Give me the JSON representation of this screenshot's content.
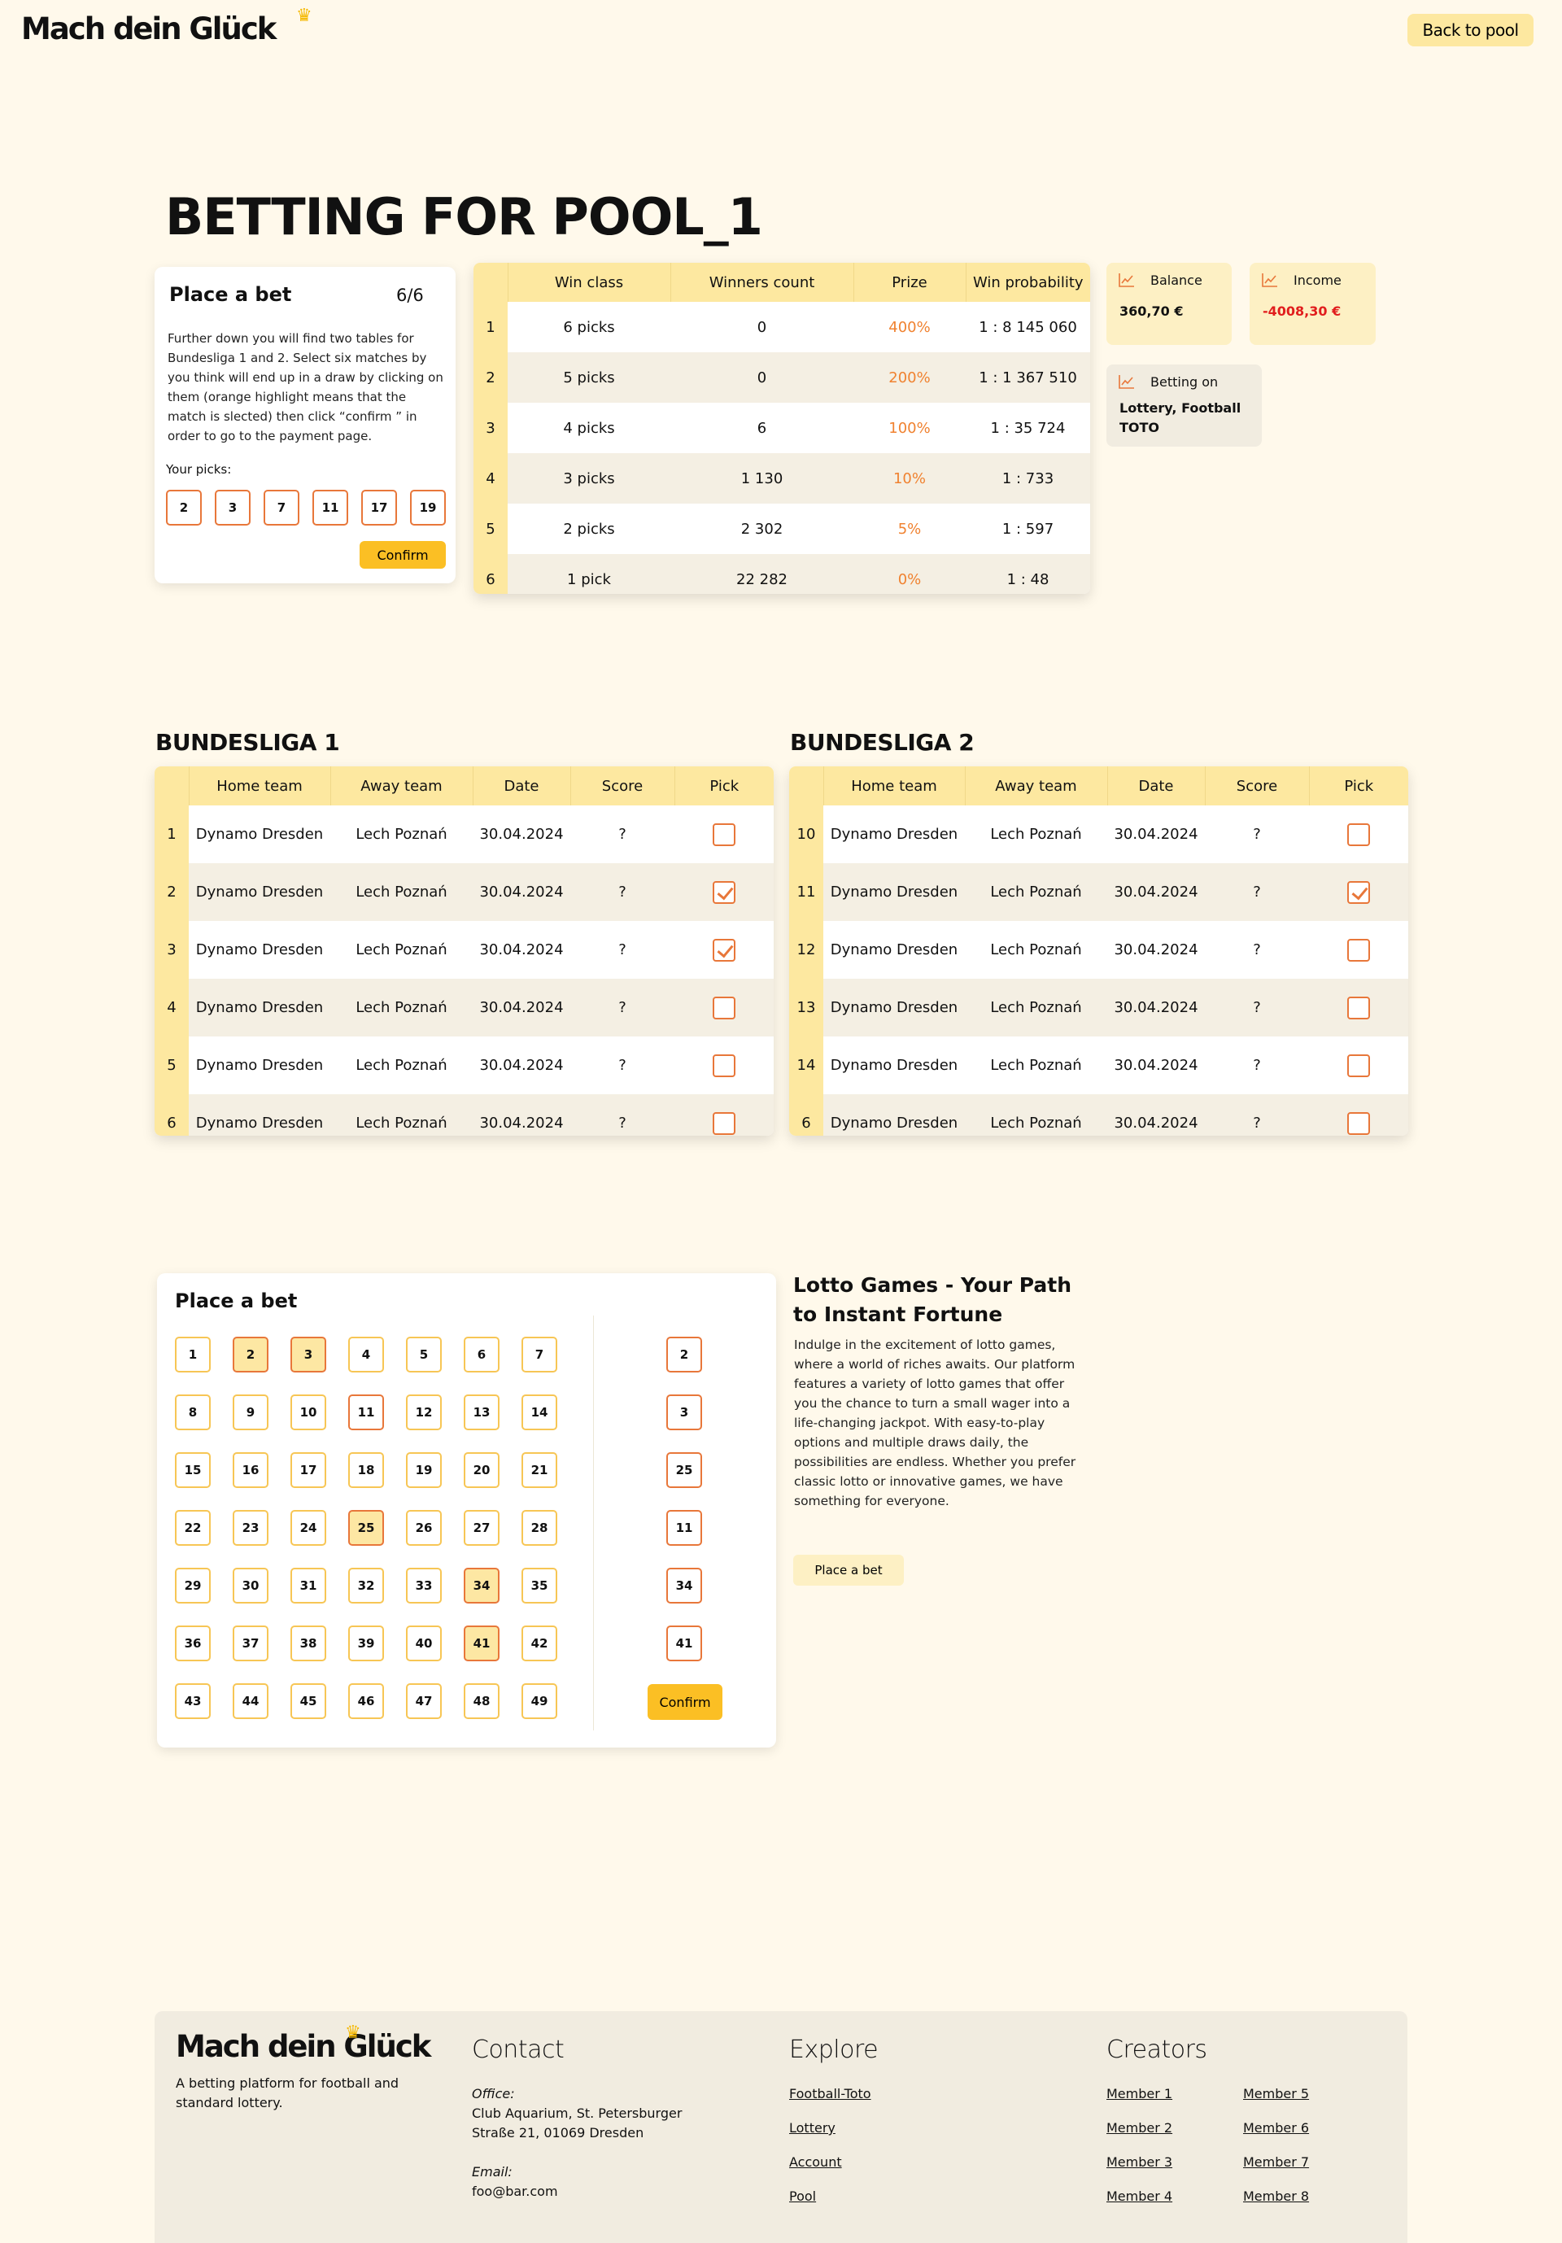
{
  "header": {
    "logo": "Mach dein Glück",
    "back_label": "Back to pool"
  },
  "page_title": "BETTING FOR POOL_1",
  "bet_card": {
    "title": "Place a bet",
    "count": "6/6",
    "description": "Further down you will find two tables for Bundesliga 1 and 2. Select six matches by you think will end up in a draw by clicking on them (orange highlight means that the match is slected) then click “confirm ” in order to go to the payment page.",
    "picks_label": "Your picks:",
    "picks": [
      "2",
      "3",
      "7",
      "11",
      "17",
      "19"
    ],
    "confirm_label": "Confirm"
  },
  "win_table": {
    "headers": [
      "Win class",
      "Winners count",
      "Prize",
      "Win probability"
    ],
    "rows": [
      {
        "idx": "1",
        "cls": "6 picks",
        "winners": "0",
        "prize": "400%",
        "prob": "1 : 8 145 060"
      },
      {
        "idx": "2",
        "cls": "5 picks",
        "winners": "0",
        "prize": "200%",
        "prob": "1 : 1 367 510"
      },
      {
        "idx": "3",
        "cls": "4 picks",
        "winners": "6",
        "prize": "100%",
        "prob": "1 : 35 724"
      },
      {
        "idx": "4",
        "cls": "3 picks",
        "winners": "1 130",
        "prize": "10%",
        "prob": "1 : 733"
      },
      {
        "idx": "5",
        "cls": "2 picks",
        "winners": "2 302",
        "prize": "5%",
        "prob": "1 : 597"
      },
      {
        "idx": "6",
        "cls": "1 pick",
        "winners": "22 282",
        "prize": "0%",
        "prob": "1 : 48"
      }
    ]
  },
  "stats": {
    "balance": {
      "label": "Balance",
      "value": "360,70 €"
    },
    "income": {
      "label": "Income",
      "value": "-4008,30 €"
    },
    "betting_on": {
      "label": "Betting on",
      "line1": "Lottery, Football",
      "line2": "TOTO"
    }
  },
  "bundesliga1": {
    "title": "BUNDESLIGA 1",
    "headers": [
      "Home team",
      "Away team",
      "Date",
      "Score",
      "Pick"
    ],
    "rows": [
      {
        "idx": "1",
        "home": "Dynamo Dresden",
        "away": "Lech Poznań",
        "date": "30.04.2024",
        "score": "?",
        "picked": false
      },
      {
        "idx": "2",
        "home": "Dynamo Dresden",
        "away": "Lech Poznań",
        "date": "30.04.2024",
        "score": "?",
        "picked": true
      },
      {
        "idx": "3",
        "home": "Dynamo Dresden",
        "away": "Lech Poznań",
        "date": "30.04.2024",
        "score": "?",
        "picked": true
      },
      {
        "idx": "4",
        "home": "Dynamo Dresden",
        "away": "Lech Poznań",
        "date": "30.04.2024",
        "score": "?",
        "picked": false
      },
      {
        "idx": "5",
        "home": "Dynamo Dresden",
        "away": "Lech Poznań",
        "date": "30.04.2024",
        "score": "?",
        "picked": false
      },
      {
        "idx": "6",
        "home": "Dynamo Dresden",
        "away": "Lech Poznań",
        "date": "30.04.2024",
        "score": "?",
        "picked": false
      }
    ]
  },
  "bundesliga2": {
    "title": "BUNDESLIGA 2",
    "headers": [
      "Home team",
      "Away team",
      "Date",
      "Score",
      "Pick"
    ],
    "rows": [
      {
        "idx": "10",
        "home": "Dynamo Dresden",
        "away": "Lech Poznań",
        "date": "30.04.2024",
        "score": "?",
        "picked": false
      },
      {
        "idx": "11",
        "home": "Dynamo Dresden",
        "away": "Lech Poznań",
        "date": "30.04.2024",
        "score": "?",
        "picked": true
      },
      {
        "idx": "12",
        "home": "Dynamo Dresden",
        "away": "Lech Poznań",
        "date": "30.04.2024",
        "score": "?",
        "picked": false
      },
      {
        "idx": "13",
        "home": "Dynamo Dresden",
        "away": "Lech Poznań",
        "date": "30.04.2024",
        "score": "?",
        "picked": false
      },
      {
        "idx": "14",
        "home": "Dynamo Dresden",
        "away": "Lech Poznań",
        "date": "30.04.2024",
        "score": "?",
        "picked": false
      },
      {
        "idx": "6",
        "home": "Dynamo Dresden",
        "away": "Lech Poznań",
        "date": "30.04.2024",
        "score": "?",
        "picked": false
      }
    ]
  },
  "lotto": {
    "title": "Place a bet",
    "numbers": [
      "1",
      "2",
      "3",
      "4",
      "5",
      "6",
      "7",
      "8",
      "9",
      "10",
      "11",
      "12",
      "13",
      "14",
      "15",
      "16",
      "17",
      "18",
      "19",
      "20",
      "21",
      "22",
      "23",
      "24",
      "25",
      "26",
      "27",
      "28",
      "29",
      "30",
      "31",
      "32",
      "33",
      "34",
      "35",
      "36",
      "37",
      "38",
      "39",
      "40",
      "41",
      "42",
      "43",
      "44",
      "45",
      "46",
      "47",
      "48",
      "49"
    ],
    "selected": [
      "2",
      "3",
      "25",
      "34",
      "41"
    ],
    "outlined": [
      "11"
    ],
    "side_picks": [
      "2",
      "3",
      "25",
      "11",
      "34",
      "41"
    ],
    "confirm_label": "Confirm"
  },
  "promo": {
    "title": "Lotto Games - Your Path to Instant Fortune",
    "text": "Indulge in the excitement of lotto games, where a world of riches awaits. Our platform features a variety of lotto games that offer you the chance to turn a small wager into a life-changing jackpot. With easy-to-play options and multiple draws daily, the possibilities are endless. Whether you prefer classic lotto or innovative games, we have something for everyone.",
    "button_label": "Place a bet"
  },
  "footer": {
    "logo": "Mach dein Glück",
    "tagline": "A betting platform for football and standard lottery.",
    "contact": {
      "title": "Contact",
      "office_label": "Office:",
      "office_line1": "Club Aquarium, St. Petersburger",
      "office_line2": "Straße 21, 01069 Dresden",
      "email_label": "Email:",
      "email": "foo@bar.com"
    },
    "explore": {
      "title": "Explore",
      "links": [
        "Football-Toto",
        "Lottery",
        "Account",
        "Pool"
      ]
    },
    "creators": {
      "title": "Creators",
      "links": [
        "Member 1",
        "Member 2",
        "Member 3",
        "Member 4",
        "Member 5",
        "Member 6",
        "Member 7",
        "Member 8"
      ]
    }
  }
}
